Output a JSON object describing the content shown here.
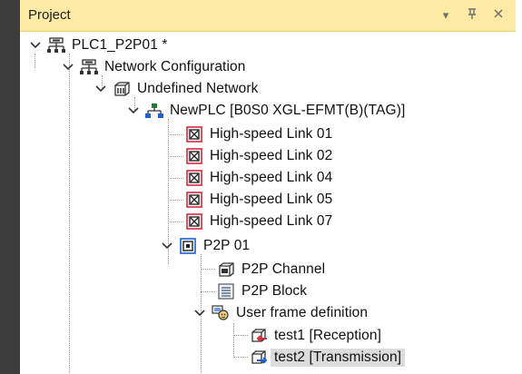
{
  "panel": {
    "title": "Project",
    "controls": {
      "dropdown_glyph": "▾",
      "pin_glyph": "ᛘ",
      "close_glyph": "✕"
    }
  },
  "colors": {
    "header_bg": "#fdeaa4",
    "selection_bg": "#dcdcdc",
    "tree_line": "#9a9a9a",
    "link_icon_red": "#d8283c",
    "p2p_icon_blue": "#1f5fd1"
  },
  "tree": {
    "root": {
      "label": "PLC1_P2P01 *",
      "icon": "project-network-icon",
      "expanded": true
    },
    "network_configuration": {
      "label": "Network Configuration",
      "icon": "network-config-icon",
      "expanded": true
    },
    "undefined_network": {
      "label": "Undefined Network",
      "icon": "undefined-network-icon",
      "expanded": true
    },
    "newplc": {
      "label": "NewPLC [B0S0 XGL-EFMT(B)(TAG)]",
      "icon": "plc-module-icon",
      "expanded": true
    },
    "links": [
      {
        "label": "High-speed Link 01",
        "icon": "high-speed-link-icon"
      },
      {
        "label": "High-speed Link 02",
        "icon": "high-speed-link-icon"
      },
      {
        "label": "High-speed Link 04",
        "icon": "high-speed-link-icon"
      },
      {
        "label": "High-speed Link 05",
        "icon": "high-speed-link-icon"
      },
      {
        "label": "High-speed Link 07",
        "icon": "high-speed-link-icon"
      }
    ],
    "p2p": {
      "label": "P2P 01",
      "icon": "p2p-icon",
      "expanded": true
    },
    "p2p_channel": {
      "label": "P2P Channel",
      "icon": "p2p-channel-icon"
    },
    "p2p_block": {
      "label": "P2P Block",
      "icon": "p2p-block-icon"
    },
    "user_frame": {
      "label": "User frame definition",
      "icon": "user-frame-icon",
      "expanded": true
    },
    "frames": [
      {
        "label": "test1 [Reception]",
        "icon": "frame-reception-icon",
        "selected": false
      },
      {
        "label": "test2 [Transmission]",
        "icon": "frame-transmission-icon",
        "selected": true
      }
    ]
  }
}
